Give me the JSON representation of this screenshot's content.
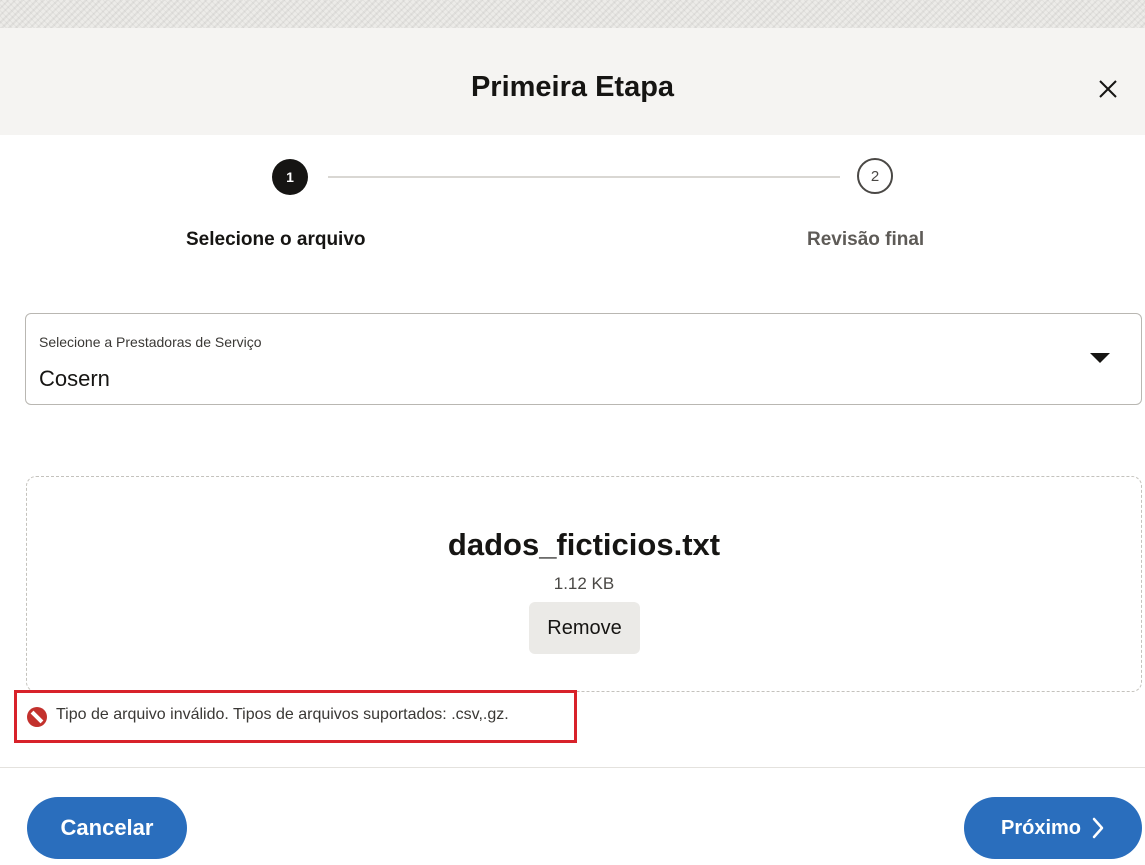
{
  "dialog": {
    "title": "Primeira Etapa",
    "close_icon": "close-icon"
  },
  "stepper": {
    "steps": [
      {
        "number": "1",
        "label": "Selecione o arquivo",
        "state": "active"
      },
      {
        "number": "2",
        "label": "Revisão final",
        "state": "pending"
      }
    ]
  },
  "provider_select": {
    "label": "Selecione a Prestadoras de Serviço",
    "value": "Cosern",
    "icon": "caret-down-icon"
  },
  "file_upload": {
    "file_name": "dados_ficticios.txt",
    "file_size": "1.12 KB",
    "remove_label": "Remove"
  },
  "error": {
    "icon": "error-icon",
    "message": "Tipo de arquivo inválido. Tipos de arquivos suportados: .csv,.gz.",
    "color": "#c3312d"
  },
  "footer": {
    "cancel_label": "Cancelar",
    "next_label": "Próximo",
    "next_icon": "chevron-right-icon"
  },
  "colors": {
    "primary": "#2a6ebd",
    "header_bg": "#f5f4f2",
    "highlight_border": "#d8222a"
  }
}
